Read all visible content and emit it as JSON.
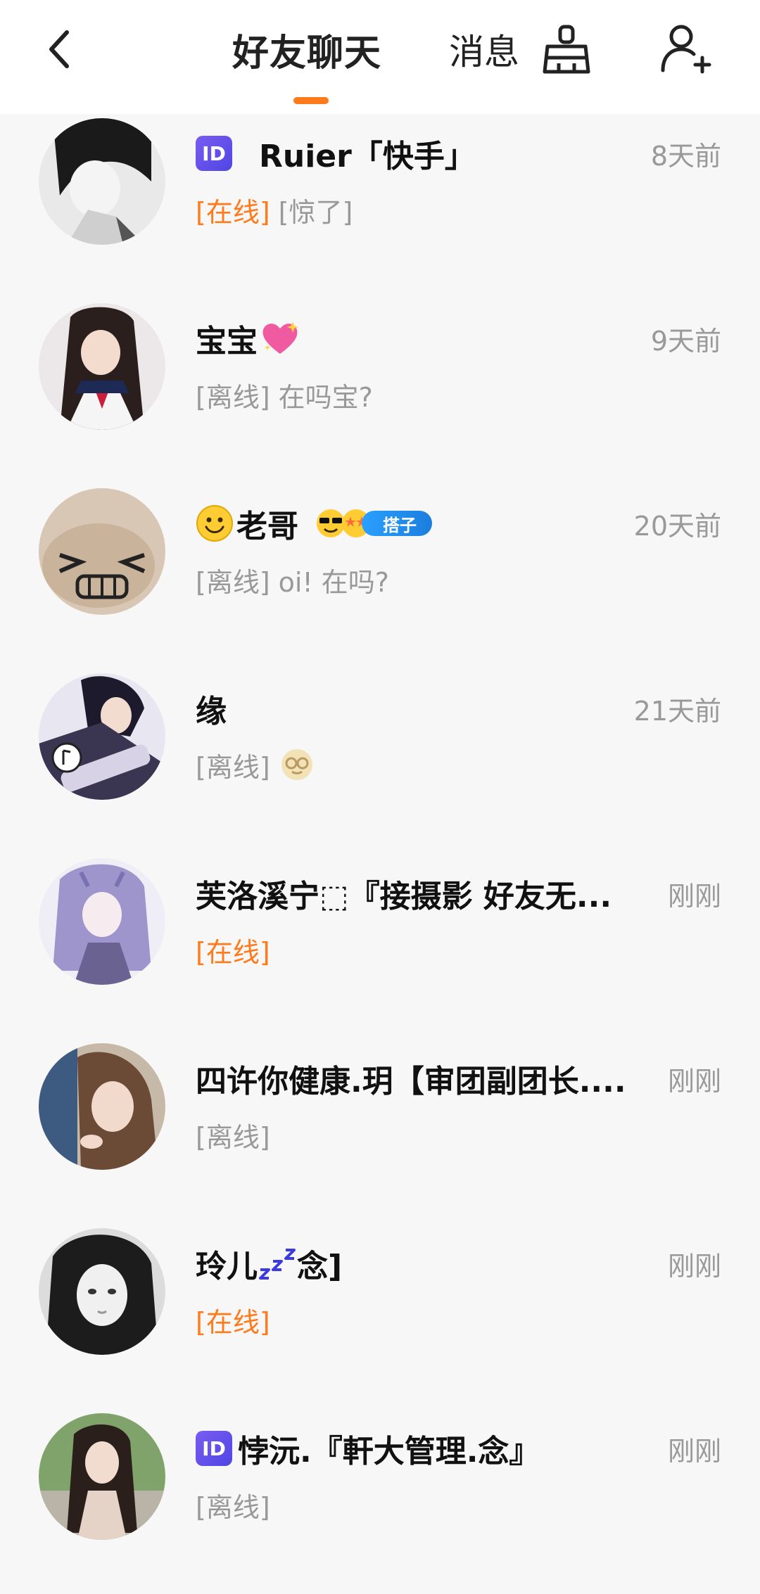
{
  "header": {
    "active_tab": "好友聊天",
    "inactive_tab": "消息",
    "icons": {
      "back": "back-arrow-icon",
      "clean": "broom-icon",
      "add_friend": "add-friend-icon"
    }
  },
  "colors": {
    "accent": "#ff7a1a",
    "offline": "#999999",
    "id_badge": "#6a50e8",
    "tag_badge": "#2a93f0"
  },
  "conversations": [
    {
      "name": "Ruier「快手」",
      "time": "8天前",
      "status": "[在线]",
      "message": "[惊了]",
      "id_badge": "ID"
    },
    {
      "name": "宝宝",
      "time": "9天前",
      "status": "[离线]",
      "message": "在吗宝?"
    },
    {
      "name": "老哥",
      "time": "20天前",
      "status": "[离线]",
      "message": "oi!  在吗?",
      "tag": "搭子"
    },
    {
      "name": "缘",
      "time": "21天前",
      "status": "[离线]",
      "message": ""
    },
    {
      "name": "芙洛溪宁⬚『接摄影 好友无...",
      "time": "刚刚",
      "status": "[在线]",
      "message": ""
    },
    {
      "name": "四许你健康.玥【审团副团长....",
      "time": "刚刚",
      "status": "[离线]",
      "message": ""
    },
    {
      "name": "玲儿",
      "name_suffix": "念]",
      "time": "刚刚",
      "status": "[在线]",
      "message": ""
    },
    {
      "name": "悖沅.『軒大管理.念』",
      "time": "刚刚",
      "status": "[离线]",
      "message": "",
      "id_badge": "ID"
    }
  ]
}
